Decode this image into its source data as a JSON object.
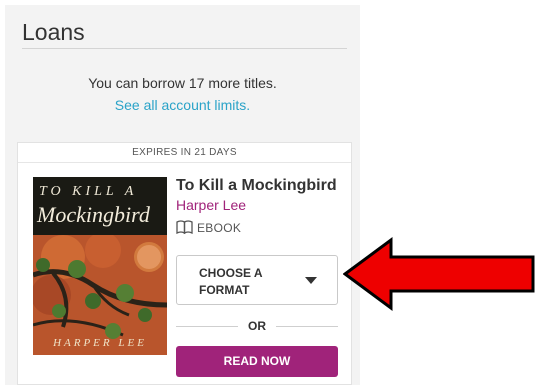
{
  "loans": {
    "title": "Loans",
    "borrow_message": "You can borrow 17 more titles.",
    "limits_link": "See all account limits."
  },
  "loan_card": {
    "expires_label": "EXPIRES IN 21 DAYS",
    "cover": {
      "line1": "TO KILL A",
      "line2": "Mockingbird",
      "byline": "HARPER LEE"
    },
    "title": "To Kill a Mockingbird",
    "author": "Harper Lee",
    "format": "EBOOK",
    "format_icon": "open-book-icon",
    "choose_format_label": "CHOOSE A FORMAT",
    "chevron_icon": "chevron-down-icon",
    "or_label": "OR",
    "read_now_label": "READ NOW"
  },
  "annotation": {
    "arrow_icon": "arrow-left-icon",
    "arrow_color": "#ee0000"
  },
  "colors": {
    "accent": "#a0237a",
    "link": "#2aa3c8",
    "panel_background": "#f3f3f3"
  }
}
